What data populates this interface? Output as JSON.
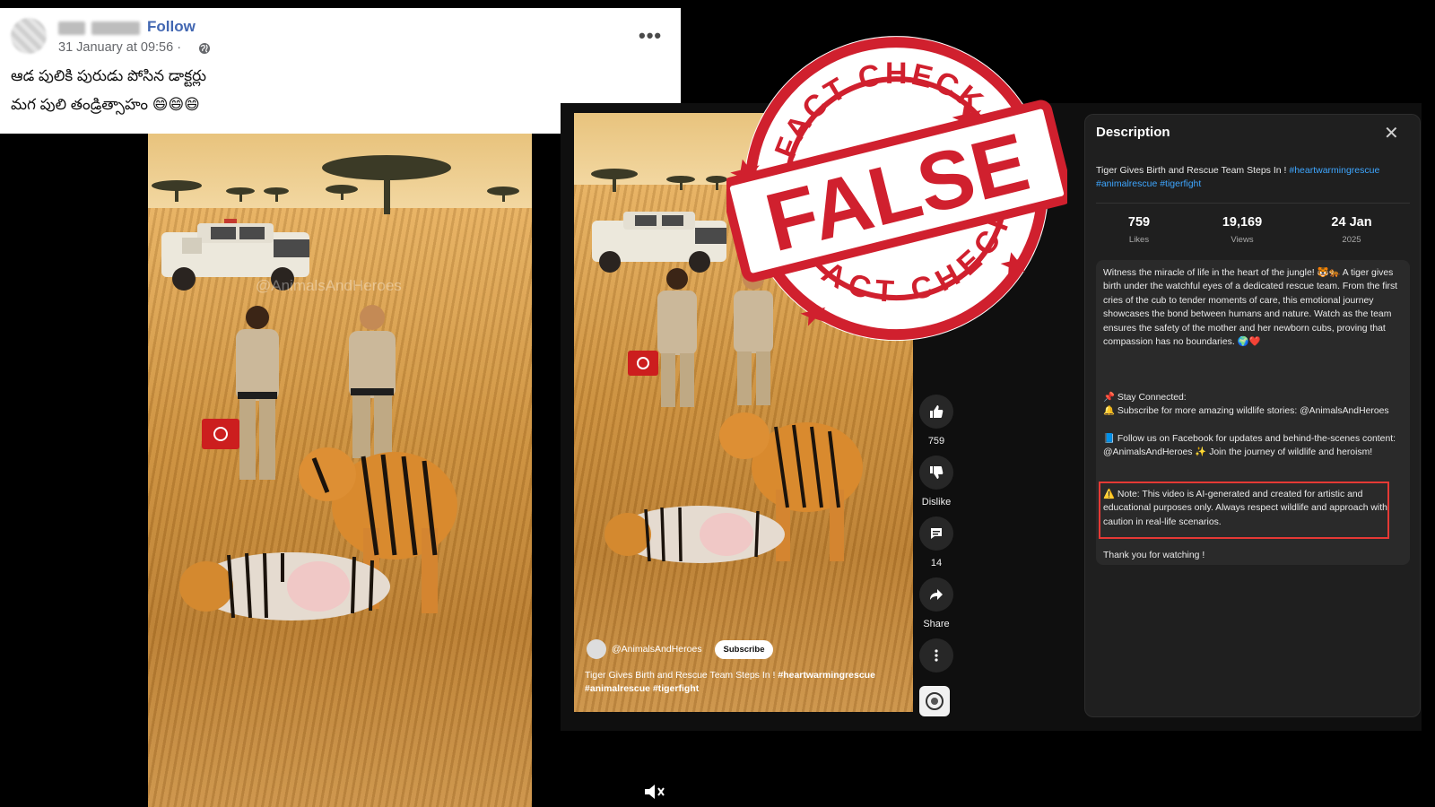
{
  "facebook_post": {
    "follow_label": "Follow",
    "timestamp": "31 January at 09:56 ·",
    "text_line1": "ఆడ పులికి పురుడు పోసిన డాక్టర్లు",
    "text_line2": "మగ పులి తండ్రిత్సాహం 😄😄😄",
    "more_label": "•••"
  },
  "left_video": {
    "watermark": "@AnimalsAndHeroes"
  },
  "youtube": {
    "actions": {
      "likes_count": "759",
      "dislike_label": "Dislike",
      "comments_count": "14",
      "share_label": "Share"
    },
    "overlay": {
      "channel": "@AnimalsAndHeroes",
      "subscribe_label": "Subscribe",
      "caption_text": "Tiger Gives Birth and Rescue Team Steps In ! ",
      "caption_tags": "#heartwarmingrescue #animalrescue #tigerfight"
    },
    "description": {
      "title": "Description",
      "video_title": "Tiger Gives Birth and Rescue Team Steps In ! ",
      "video_tag1": "#heartwarmingrescue",
      "video_tag2": "#animalrescue #tigerfight",
      "stats": {
        "likes_value": "759",
        "likes_label": "Likes",
        "views_value": "19,169",
        "views_label": "Views",
        "date_value": "24 Jan",
        "date_label": "2025"
      },
      "body_para1": "Witness the miracle of life in the heart of the jungle! 🐯🐅 A tiger gives birth under the watchful eyes of a dedicated rescue team. From the first cries of the cub to tender moments of care, this emotional journey showcases the bond between humans and nature. Watch as the team ensures the safety of the mother and her newborn cubs, proving that compassion has no boundaries. 🌍❤️",
      "stay_connected": "📌 Stay Connected:",
      "subscribe_line": "🔔 Subscribe for more amazing wildlife stories: @AnimalsAndHeroes",
      "follow_line": "📘 Follow us on Facebook for updates and behind-the-scenes content: @AnimalsAndHeroes ✨ Join the journey of wildlife and heroism!",
      "note": "⚠️ Note: This video is AI-generated and created for artistic and educational purposes only. Always respect wildlife and approach with caution in real-life scenarios.",
      "thanks": "Thank you for watching !"
    }
  },
  "stamp": {
    "top_text": "FACT CHECK",
    "verdict": "FALSE",
    "bottom_text": "FACT CHECK",
    "color": "#d0202e"
  }
}
